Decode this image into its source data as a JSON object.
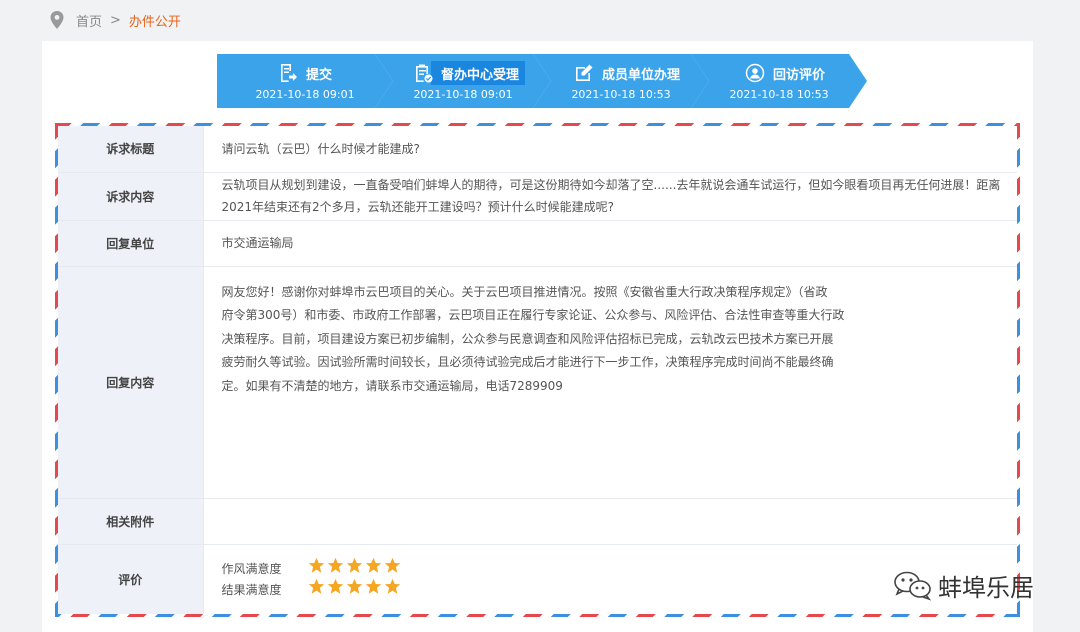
{
  "breadcrumb": {
    "home": "首页",
    "separator": ">",
    "current": "办件公开"
  },
  "steps": [
    {
      "label": "提交",
      "time": "2021-10-18 09:01",
      "icon": "edit-doc-icon"
    },
    {
      "label": "督办中心受理",
      "time": "2021-10-18 09:01",
      "icon": "clipboard-check-icon"
    },
    {
      "label": "成员单位办理",
      "time": "2021-10-18 10:53",
      "icon": "pencil-square-icon"
    },
    {
      "label": "回访评价",
      "time": "2021-10-18 10:53",
      "icon": "user-service-icon"
    }
  ],
  "colors": {
    "step": "#3aa3ea",
    "step_active_highlight": "#1b86df",
    "star": "#f5a623",
    "accent": "#e8641b"
  },
  "details": {
    "title_label": "诉求标题",
    "title_value": "请问云轨（云巴）什么时候才能建成?",
    "content_label": "诉求内容",
    "content_value": "云轨项目从规划到建设，一直备受咱们蚌埠人的期待，可是这份期待如今却落了空......去年就说会通车试运行，但如今眼看项目再无任何进展！距离2021年结束还有2个多月，云轨还能开工建设吗？预计什么时候能建成呢?",
    "unit_label": "回复单位",
    "unit_value": "市交通运输局",
    "reply_label": "回复内容",
    "reply_lines": [
      "网友您好！感谢你对蚌埠市云巴项目的关心。关于云巴项目推进情况。按照《安徽省重大行政决策程序规定》（省政",
      "府令第300号）和市委、市政府工作部署，云巴项目正在履行专家论证、公众参与、风险评估、合法性审查等重大行政",
      "决策程序。目前，项目建设方案已初步编制，公众参与民意调查和风险评估招标已完成，云轨改云巴技术方案已开展",
      "疲劳耐久等试验。因试验所需时间较长，且必须待试验完成后才能进行下一步工作，决策程序完成时间尚不能最终确",
      "定。如果有不清楚的地方，请联系市交通运输局，电话7289909"
    ],
    "attachment_label": "相关附件",
    "rating_label": "评价",
    "ratings": [
      {
        "label": "作风满意度",
        "stars": 5,
        "max": 5
      },
      {
        "label": "结果满意度",
        "stars": 5,
        "max": 5
      }
    ]
  },
  "watermark": {
    "text": "蚌埠乐居",
    "icon": "wechat-icon"
  }
}
